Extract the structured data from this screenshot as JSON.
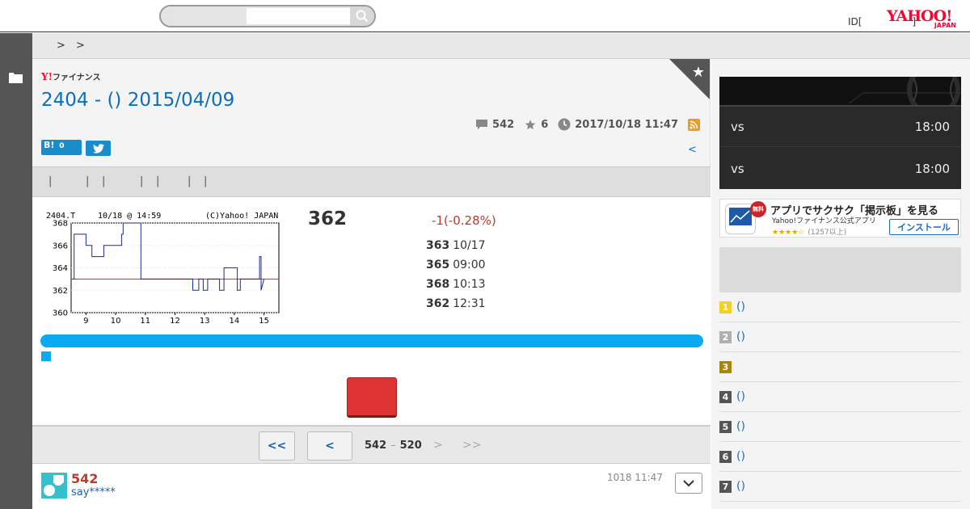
{
  "search": {
    "placeholder": ""
  },
  "header": {
    "id_text": "ID[",
    "id_bracket": "]",
    "logo_main": "YAHOO!",
    "logo_sub": "JAPAN"
  },
  "breadcrumb": {
    "sep1": ">",
    "sep2": ">"
  },
  "finance_logo": {
    "y": "Y!",
    "text": "ファイナンス"
  },
  "page_title": "2404 - () 2015/04/09",
  "meta": {
    "comments": "542",
    "favorites": "6",
    "updated": "2017/10/18 11:47"
  },
  "share": {
    "hatebu_label": "B!",
    "hatebu_count": "0"
  },
  "prev_link": "<",
  "tabs": [
    "|",
    "|",
    "|",
    "|",
    "|",
    "|",
    "|"
  ],
  "stock": {
    "price": "362",
    "change": "-1(-0.28%)",
    "quotes": [
      {
        "value": "363",
        "time": "10/17"
      },
      {
        "value": "365",
        "time": "09:00"
      },
      {
        "value": "368",
        "time": "10:13"
      },
      {
        "value": "362",
        "time": "12:31"
      }
    ]
  },
  "chart_data": {
    "type": "line",
    "header_left": "2404.T",
    "header_mid": "10/18 @ 14:59",
    "header_right": "(C)Yahoo! JAPAN",
    "x_ticks": [
      "9",
      "10",
      "11",
      "12",
      "13",
      "14",
      "15"
    ],
    "y_ticks": [
      "360",
      "362",
      "364",
      "366",
      "368"
    ],
    "ylim": [
      360,
      368
    ],
    "xlim": [
      8.5,
      15.5
    ],
    "baseline": 363,
    "series": [
      {
        "x": [
          8.55,
          8.6,
          8.6,
          9.0,
          9.0,
          9.2,
          9.2,
          9.6,
          9.6,
          9.9,
          9.9,
          10.2,
          10.2,
          10.25,
          10.25,
          10.5,
          10.5,
          10.8,
          10.8,
          10.85,
          10.85,
          11.5,
          11.5,
          12.6,
          12.6,
          12.8,
          12.8,
          12.95,
          12.95,
          13.1,
          13.1,
          13.5,
          13.5,
          13.65,
          13.65,
          14.1,
          14.1,
          14.2,
          14.2,
          14.3,
          14.3,
          14.5,
          14.5,
          14.75,
          14.75,
          14.85,
          14.85,
          14.9,
          14.9,
          15.0
        ],
        "y": [
          363,
          363,
          367,
          367,
          366,
          366,
          365,
          365,
          366,
          366,
          366,
          366,
          367,
          367,
          368,
          368,
          368,
          368,
          368,
          368,
          363,
          363,
          363,
          363,
          362,
          362,
          363,
          363,
          362,
          362,
          363,
          363,
          362,
          362,
          364,
          364,
          362,
          362,
          363,
          363,
          363,
          363,
          363,
          363,
          363,
          363,
          365,
          365,
          362,
          363
        ]
      }
    ]
  },
  "pager": {
    "first": "<<",
    "prev": "<",
    "range_start": "542",
    "range_dash": "–",
    "range_end": "520",
    "next": ">",
    "last": ">>"
  },
  "post": {
    "number": "542",
    "user": "say*****",
    "time": "1018 11:47"
  },
  "baseball": [
    {
      "vs": "vs",
      "time": "18:00"
    },
    {
      "vs": "vs",
      "time": "18:00"
    }
  ],
  "app_ad": {
    "free": "無料",
    "title": "アプリでサクサク「掲示板」を見る",
    "subtitle": "Yahoo!ファイナンス公式アプリ",
    "stars": "★★★★☆",
    "count": "(1257以上)",
    "install": "インストール"
  },
  "ranking": [
    {
      "rank": "1",
      "text": "()",
      "color": "#f5d020"
    },
    {
      "rank": "2",
      "text": "()",
      "color": "#b0b0b0"
    },
    {
      "rank": "3",
      "text": "",
      "color": "#a8860b"
    },
    {
      "rank": "4",
      "text": "()",
      "color": "#555555"
    },
    {
      "rank": "5",
      "text": "()",
      "color": "#555555"
    },
    {
      "rank": "6",
      "text": "()",
      "color": "#555555"
    },
    {
      "rank": "7",
      "text": "()",
      "color": "#555555"
    }
  ]
}
